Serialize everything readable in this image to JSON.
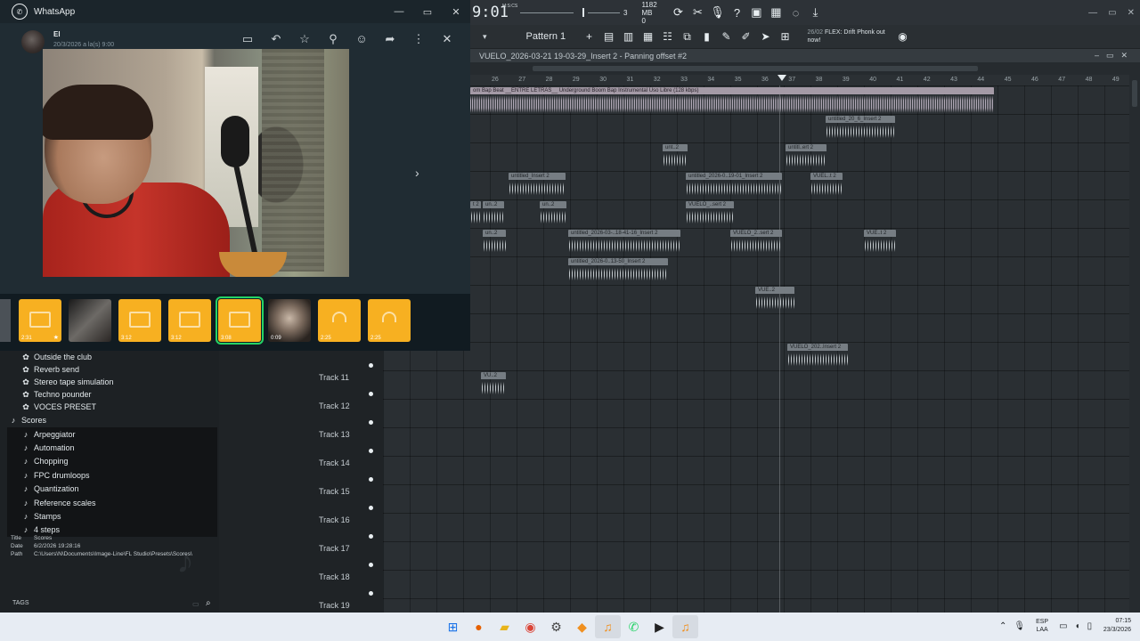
{
  "fl": {
    "time": "9:01",
    "time_small": "M:S:CS",
    "memory": "1182 MB",
    "memory_sub": "0",
    "tempo_digit": "3",
    "pattern": "Pattern 1",
    "news": {
      "date": "26/02",
      "text": "FLEX: Drift Phonk out now!"
    },
    "playlist_title": "VUELO_2026-03-21 19-03-29_Insert 2 - Panning offset #2",
    "ruler": [
      "26",
      "27",
      "28",
      "29",
      "30",
      "31",
      "32",
      "33",
      "34",
      "35",
      "36",
      "37",
      "38",
      "39",
      "40",
      "41",
      "42",
      "43",
      "44",
      "45",
      "46",
      "47",
      "48",
      "49"
    ],
    "top_clip_label": "om Bap Beat __ENTRE LETRAS__ Underground Boom Bap Instrumental Uso Libre (128 kbps)",
    "clips": [
      {
        "label": "untitled_20_6_Insert 2"
      },
      {
        "label": "unt..2"
      },
      {
        "label": "untitl..ert 2"
      },
      {
        "label": "untitled_Insert 2"
      },
      {
        "label": "untitled_2026-0..19-01_Insert 2"
      },
      {
        "label": "VUEL..t 2"
      },
      {
        "label": "t 2"
      },
      {
        "label": "un..2"
      },
      {
        "label": "un..2"
      },
      {
        "label": "VUELO_..sert 2"
      },
      {
        "label": "un..2"
      },
      {
        "label": "untitled_2026-03-..18-41-16_Insert 2"
      },
      {
        "label": "VUELO_2..sert 2"
      },
      {
        "label": "VUE..t 2"
      },
      {
        "label": "untitled_2026-0..13-50_Insert 2"
      },
      {
        "label": "VUE..2"
      },
      {
        "label": "VUELO_202..Insert 2"
      },
      {
        "label": "VU..2"
      }
    ],
    "tracks": [
      "Track 11",
      "Track 12",
      "Track 13",
      "Track 14",
      "Track 15",
      "Track 16",
      "Track 17",
      "Track 18",
      "Track 19"
    ]
  },
  "browser": {
    "items": [
      {
        "icon": "gear-icon",
        "label": "Outside the club",
        "level": 1
      },
      {
        "icon": "gear-icon",
        "label": "Reverb send",
        "level": 1
      },
      {
        "icon": "gear-icon",
        "label": "Stereo tape simulation",
        "level": 1
      },
      {
        "icon": "gear-icon",
        "label": "Techno pounder",
        "level": 1
      },
      {
        "icon": "gear-icon",
        "label": "VOCES PRESET",
        "level": 1
      },
      {
        "icon": "music-note-icon",
        "label": "Scores",
        "level": 0
      },
      {
        "icon": "music-note-icon",
        "label": "Arpeggiator",
        "level": 1
      },
      {
        "icon": "music-note-icon",
        "label": "Automation",
        "level": 1
      },
      {
        "icon": "music-note-icon",
        "label": "Chopping",
        "level": 1
      },
      {
        "icon": "music-note-icon",
        "label": "FPC drumloops",
        "level": 1
      },
      {
        "icon": "music-note-icon",
        "label": "Quantization",
        "level": 1
      },
      {
        "icon": "music-note-icon",
        "label": "Reference scales",
        "level": 1
      },
      {
        "icon": "music-note-icon",
        "label": "Stamps",
        "level": 1
      },
      {
        "icon": "music-note-icon",
        "label": "4 steps",
        "level": 1
      }
    ],
    "meta": {
      "title_key": "Title",
      "title": "Scores",
      "date_key": "Date",
      "date": "6/2/2026 19:28:16",
      "path_key": "Path",
      "path": "C:\\Users\\N\\Documents\\Image-Line\\FL Studio\\Presets\\Scores\\"
    },
    "tags": "TAGS"
  },
  "whatsapp": {
    "app_title": "WhatsApp",
    "contact": "El",
    "subtitle": "20/3/2026 a la(s) 9:00",
    "thumbs": [
      {
        "type": "img",
        "label": "2:31",
        "starred": true
      },
      {
        "type": "photo",
        "label": ""
      },
      {
        "type": "img",
        "label": "3:12"
      },
      {
        "type": "img",
        "label": "3:12"
      },
      {
        "type": "img",
        "label": "3:08",
        "selected": true
      },
      {
        "type": "photo2",
        "label": "0:09"
      },
      {
        "type": "audio",
        "label": "2:25"
      },
      {
        "type": "audio",
        "label": "2:25"
      }
    ]
  },
  "taskbar": {
    "lang_top": "ESP",
    "lang_bottom": "LAA",
    "time": "07:15",
    "date": "23/3/2026"
  },
  "colors": {
    "wa_accent": "#25d366",
    "fl_bg": "#2a2f33",
    "thumb_yellow": "#f7b021"
  }
}
